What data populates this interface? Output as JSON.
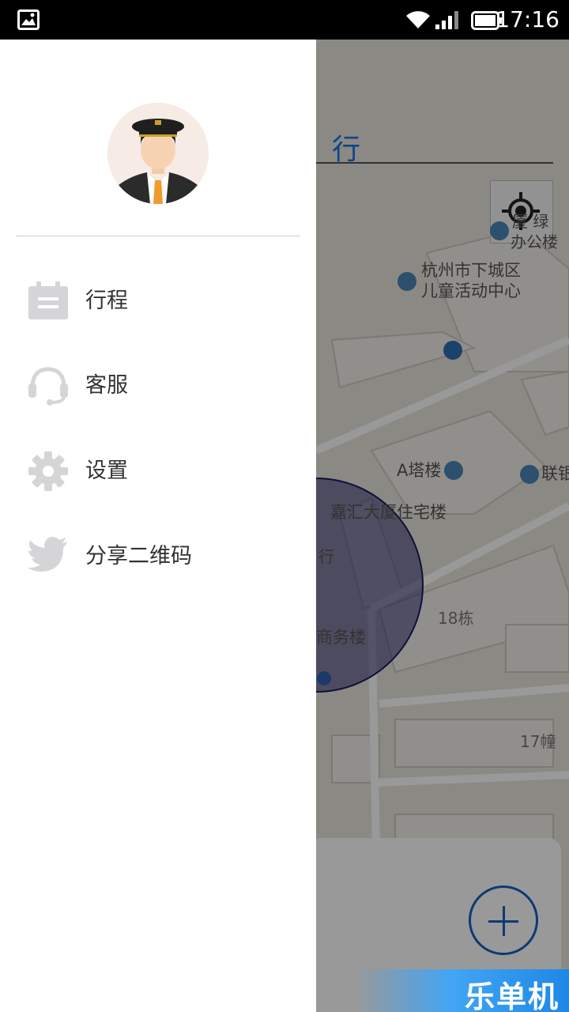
{
  "status_bar": {
    "time": "17:16"
  },
  "map": {
    "header_text": "行",
    "labels": {
      "office": "办公楼",
      "green": "厦 绿",
      "children_center_line1": "杭州市下城区",
      "children_center_line2": "儿童活动中心",
      "tower_a": "A塔楼",
      "lianke": "联银",
      "jiahui": "嘉汇大厦住宅楼",
      "bank": "行",
      "building_18": "18栋",
      "commerce": "商务楼",
      "building_17": "17幢"
    }
  },
  "drawer": {
    "menu": [
      {
        "label": "行程",
        "icon": "calendar-icon"
      },
      {
        "label": "客服",
        "icon": "headset-icon"
      },
      {
        "label": "设置",
        "icon": "gear-icon"
      },
      {
        "label": "分享二维码",
        "icon": "twitter-bird-icon"
      }
    ]
  },
  "watermark": "乐单机",
  "colors": {
    "accent": "#1a5fbf",
    "menu_icon": "#d5d5d8",
    "circle": "#2a2a6e"
  }
}
